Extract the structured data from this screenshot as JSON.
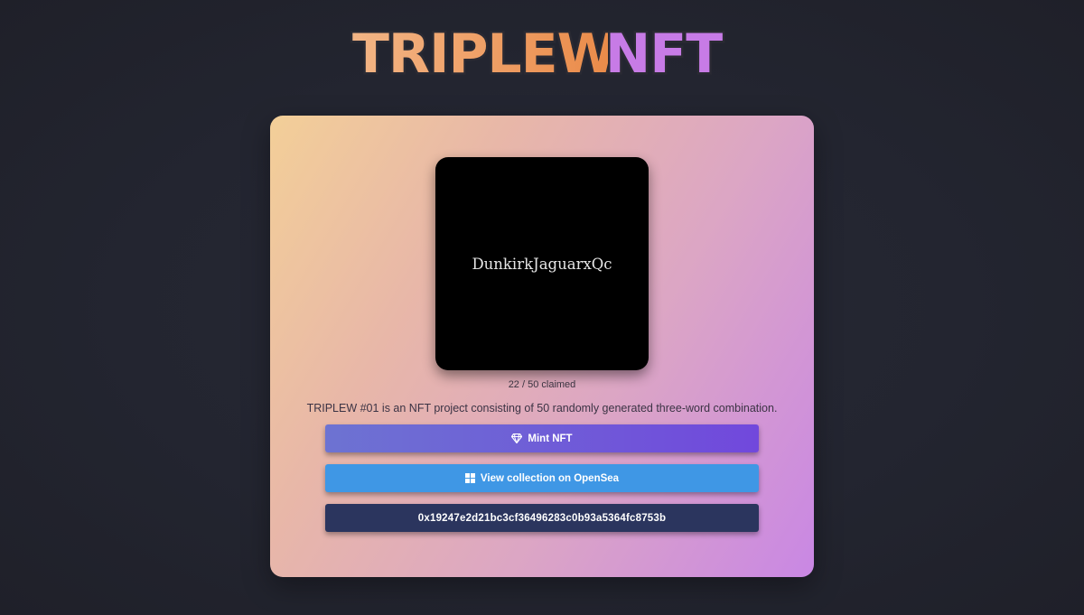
{
  "header": {
    "logo_part1": "TRIPLEW",
    "logo_part2": "NFT"
  },
  "card": {
    "nft_name": "DunkirkJaguarxQc",
    "claimed_text": "22 / 50 claimed",
    "claimed": 22,
    "total": 50,
    "description": "TRIPLEW #01 is an NFT project consisting of 50 randomly generated three-word combination.",
    "buttons": {
      "mint_label": "Mint NFT",
      "mint_icon": "diamond-icon",
      "opensea_label": "View collection on OpenSea",
      "opensea_icon": "grid-icon",
      "address_label": "0x19247e2d21bc3cf36496283c0b93a5364fc8753b"
    }
  },
  "colors": {
    "background": "#232530",
    "logo_orange": "#f0a065",
    "logo_purple": "#c77be6",
    "mint_button": "#7148dc",
    "opensea_button": "#3f97e5",
    "address_button": "#2b355e"
  }
}
